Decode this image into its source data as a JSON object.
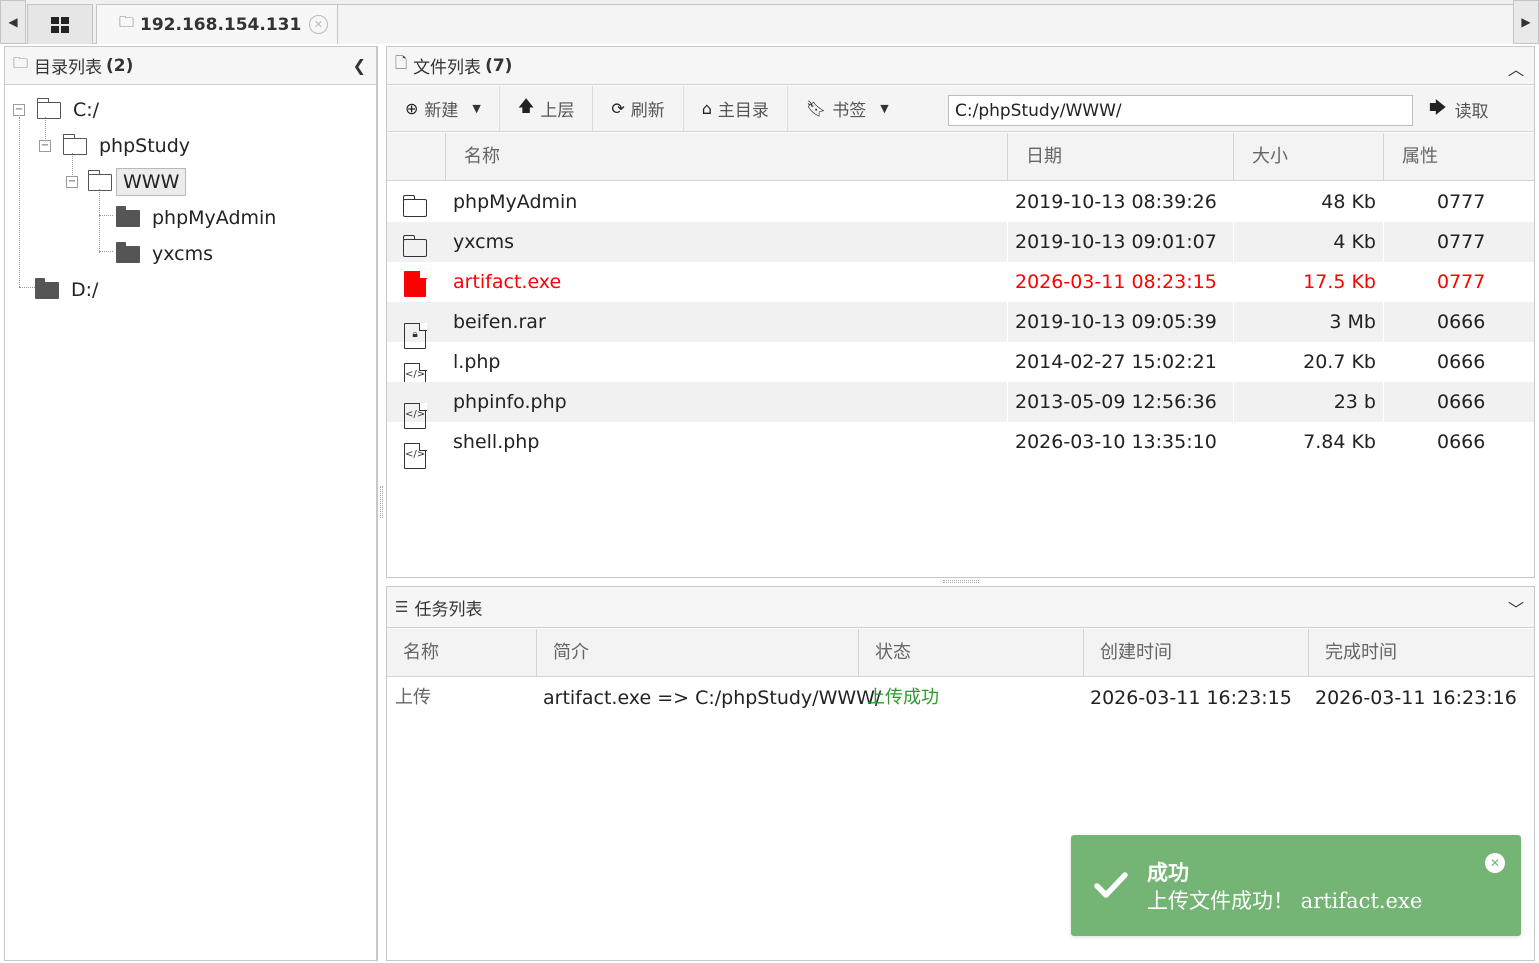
{
  "colors": {
    "success_toast": "#74b474",
    "status_green": "#2e9a2e",
    "highlight_red": "#ff0000"
  },
  "tabs": {
    "home_icon": "grid-icon",
    "host": "192.168.154.131"
  },
  "dir_panel": {
    "title": "目录列表",
    "count": "(2)",
    "tree": {
      "c_drive": "C:/",
      "phpstudy": "phpStudy",
      "www": "WWW",
      "phpmyadmin": "phpMyAdmin",
      "yxcms": "yxcms",
      "d_drive": "D:/"
    }
  },
  "file_panel": {
    "title": "文件列表",
    "count": "(7)",
    "toolbar": {
      "new": "新建",
      "up": "上层",
      "refresh": "刷新",
      "home": "主目录",
      "bookmark": "书签",
      "path": "C:/phpStudy/WWW/",
      "read": "读取"
    },
    "columns": {
      "name": "名称",
      "date": "日期",
      "size": "大小",
      "attr": "属性"
    },
    "rows": [
      {
        "icon": "folder-icon",
        "name": "phpMyAdmin",
        "date": "2019-10-13 08:39:26",
        "size": "48 Kb",
        "attr": "0777"
      },
      {
        "icon": "folder-icon",
        "name": "yxcms",
        "date": "2019-10-13 09:01:07",
        "size": "4 Kb",
        "attr": "0777"
      },
      {
        "icon": "file-icon",
        "name": "artifact.exe",
        "date": "2026-03-11 08:23:15",
        "size": "17.5 Kb",
        "attr": "0777",
        "highlight": true
      },
      {
        "icon": "archive-file-icon",
        "name": "beifen.rar",
        "date": "2019-10-13 09:05:39",
        "size": "3 Mb",
        "attr": "0666"
      },
      {
        "icon": "code-file-icon",
        "name": "l.php",
        "date": "2014-02-27 15:02:21",
        "size": "20.7 Kb",
        "attr": "0666"
      },
      {
        "icon": "code-file-icon",
        "name": "phpinfo.php",
        "date": "2013-05-09 12:56:36",
        "size": "23 b",
        "attr": "0666"
      },
      {
        "icon": "code-file-icon",
        "name": "shell.php",
        "date": "2026-03-10 13:35:10",
        "size": "7.84 Kb",
        "attr": "0666"
      }
    ]
  },
  "task_panel": {
    "title": "任务列表",
    "columns": {
      "name": "名称",
      "desc": "简介",
      "status": "状态",
      "created": "创建时间",
      "done": "完成时间"
    },
    "rows": [
      {
        "name": "上传",
        "desc": "artifact.exe => C:/phpStudy/WWW/",
        "status": "上传成功",
        "created": "2026-03-11 16:23:15",
        "done": "2026-03-11 16:23:16"
      }
    ]
  },
  "toast": {
    "title": "成功",
    "message": "上传文件成功！ artifact.exe"
  }
}
